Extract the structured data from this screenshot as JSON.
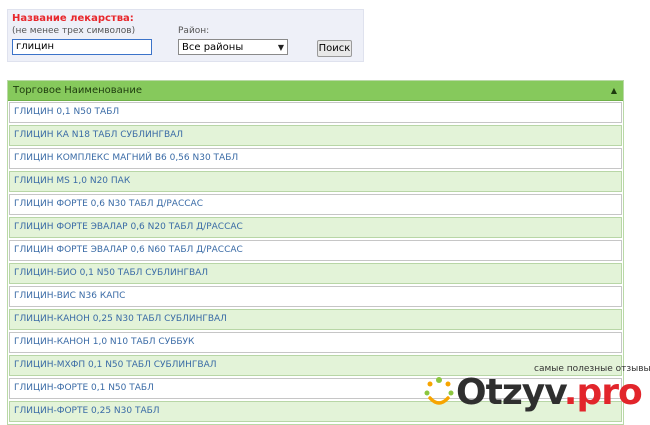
{
  "search": {
    "title_label": "Название лекарства:",
    "hint_label": "(не менее трех символов)",
    "query_value": "глицин",
    "district_label": "Район:",
    "district_value": "Все районы",
    "search_button": "Поиск"
  },
  "grid": {
    "header": "Торговое Наименование",
    "rows": [
      "ГЛИЦИН 0,1 N50 ТАБЛ",
      "ГЛИЦИН КА N18 ТАБЛ СУБЛИНГВАЛ",
      "ГЛИЦИН КОМПЛЕКС МАГНИЙ B6 0,56 N30 ТАБЛ",
      "ГЛИЦИН MS 1,0 N20 ПАК",
      "ГЛИЦИН ФОРТЕ 0,6 N30 ТАБЛ Д/РАССАС",
      "ГЛИЦИН ФОРТЕ ЭВАЛАР 0,6 N20 ТАБЛ Д/РАССАС",
      "ГЛИЦИН ФОРТЕ ЭВАЛАР 0,6 N60 ТАБЛ Д/РАССАС",
      "ГЛИЦИН-БИО 0,1 N50 ТАБЛ СУБЛИНГВАЛ",
      "ГЛИЦИН-ВИС N36 КАПС",
      "ГЛИЦИН-КАНОН 0,25 N30 ТАБЛ СУБЛИНГВАЛ",
      "ГЛИЦИН-КАНОН 1,0 N10 ТАБЛ СУББУК",
      "ГЛИЦИН-МХФП 0,1 N50 ТАБЛ СУБЛИНГВАЛ",
      "ГЛИЦИН-ФОРТЕ 0,1 N50 ТАБЛ",
      "ГЛИЦИН-ФОРТЕ 0,25 N30 ТАБЛ"
    ]
  },
  "watermark": {
    "tagline": "самые полезные отзывы",
    "brand_main": "Otzyv",
    "brand_tld": ".pro"
  },
  "colors": {
    "header_green": "#86c95c",
    "row_alt": "#e3f3d8",
    "label_red": "#e8272c",
    "row_text": "#3a6ba6"
  }
}
